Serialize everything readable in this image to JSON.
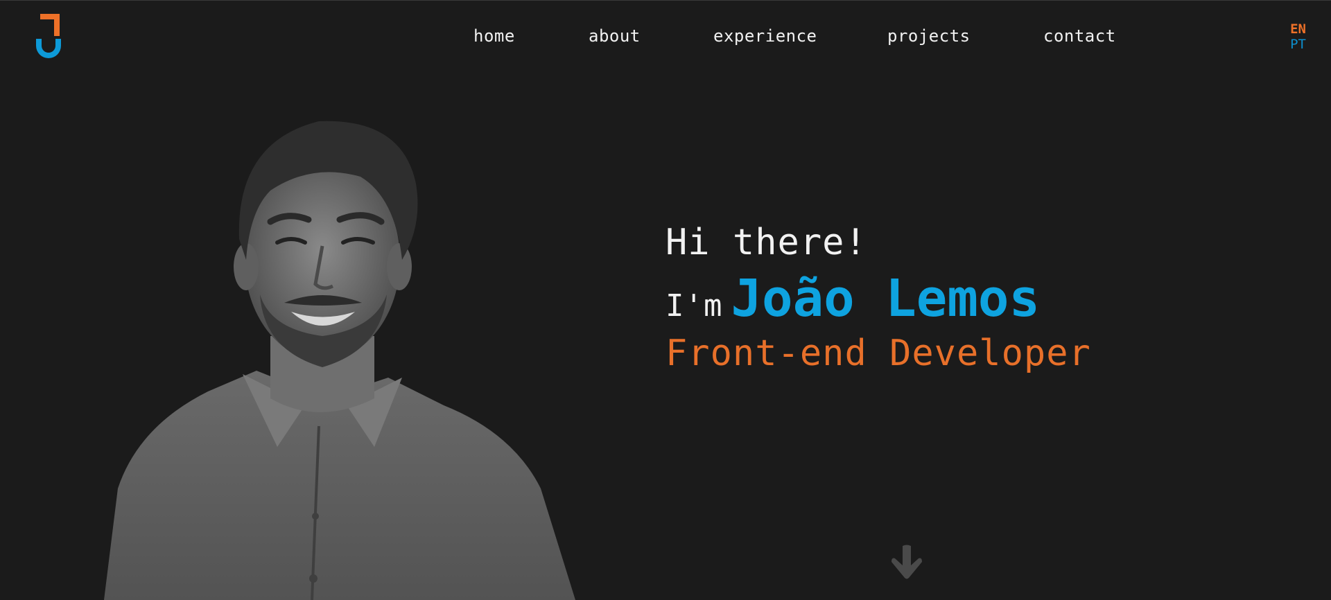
{
  "colors": {
    "background": "#1b1b1b",
    "accent_blue": "#0ea3e0",
    "accent_orange": "#e8702a",
    "text": "#f2f2f2"
  },
  "logo": {
    "icon": "j-logo-icon"
  },
  "nav": {
    "items": [
      {
        "label": "home"
      },
      {
        "label": "about"
      },
      {
        "label": "experience"
      },
      {
        "label": "projects"
      },
      {
        "label": "contact"
      }
    ]
  },
  "language": {
    "options": [
      "EN",
      "PT"
    ],
    "selected": "EN"
  },
  "hero": {
    "greeting": "Hi there!",
    "intro": "I'm",
    "name": "João Lemos",
    "role": "Front-end Developer"
  },
  "scroll_indicator": {
    "icon": "arrow-down-icon"
  }
}
